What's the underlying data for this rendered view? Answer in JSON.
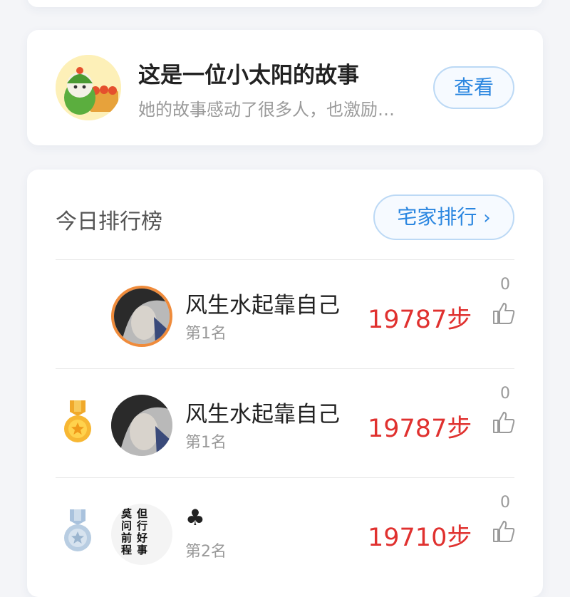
{
  "story": {
    "title": "这是一位小太阳的故事",
    "subtitle": "她的故事感动了很多人，也激励…",
    "button": "查看"
  },
  "ranking": {
    "title": "今日排行榜",
    "home_button": "宅家排行",
    "home_button_icon": "chevron-right-icon",
    "rows": [
      {
        "name": "风生水起靠自己",
        "rank": "第1名",
        "steps": "19787步",
        "likes": "0",
        "medal": "none",
        "self": true
      },
      {
        "name": "风生水起靠自己",
        "rank": "第1名",
        "steps": "19787步",
        "likes": "0",
        "medal": "gold"
      },
      {
        "name": "♣",
        "rank": "第2名",
        "steps": "19710步",
        "likes": "0",
        "medal": "silver",
        "avatar_text": "但行好事 莫问前程"
      }
    ]
  },
  "colors": {
    "accent": "#2a86e0",
    "steps": "#e0312f",
    "ring": "#ef8b3b"
  }
}
